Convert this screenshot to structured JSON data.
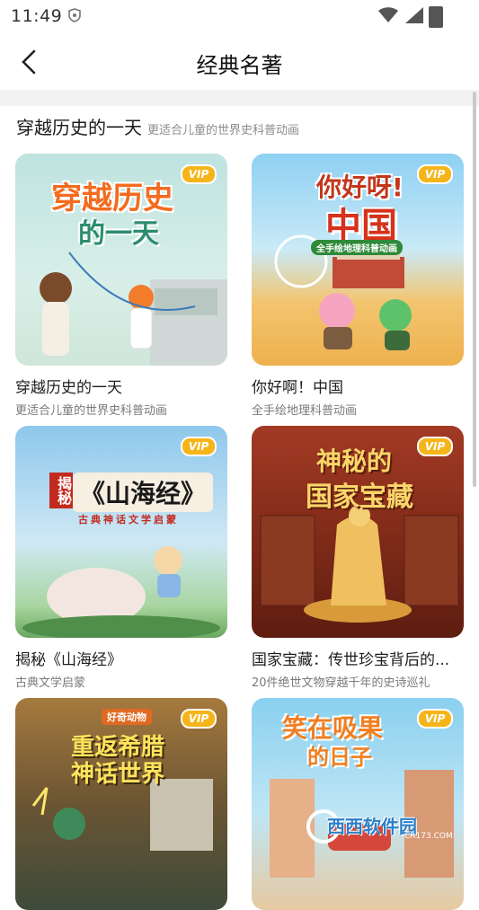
{
  "status": {
    "time": "11:49"
  },
  "nav": {
    "title": "经典名著"
  },
  "section": {
    "title": "穿越历史的一天",
    "subtitle": "更适合儿童的世界史科普动画"
  },
  "cards": [
    {
      "title": "穿越历史的一天",
      "subtitle": "更适合儿童的世界史科普动画",
      "cover_text": "穿越历史",
      "cover_text2": "的一天",
      "badge": "VIP"
    },
    {
      "title": "你好啊！中国",
      "subtitle": "全手绘地理科普动画",
      "cover_text": "你好呀!",
      "cover_text2": "中国",
      "cover_sub": "全手绘地理科普动画",
      "badge": "VIP"
    },
    {
      "title": "揭秘《山海经》",
      "subtitle": "古典文学启蒙",
      "cover_text": "《山海经》",
      "cover_side": "揭秘",
      "cover_sub": "古典神话文学启蒙",
      "badge": "VIP"
    },
    {
      "title": "国家宝藏：传世珍宝背后的...",
      "subtitle": "20件绝世文物穿越千年的史诗巡礼",
      "cover_text": "神秘的",
      "cover_text2": "国家宝藏",
      "badge": "VIP"
    },
    {
      "title": "",
      "subtitle": "",
      "cover_text": "重返希腊",
      "cover_text2": "神话世界",
      "cover_sub": "好奇动物",
      "badge": "VIP"
    },
    {
      "title": "",
      "subtitle": "",
      "cover_text": "笑在吸果",
      "cover_text2": "的日子",
      "badge": "VIP"
    }
  ],
  "watermark": {
    "text": "西西软件园",
    "url_text": "CR173.COM"
  }
}
